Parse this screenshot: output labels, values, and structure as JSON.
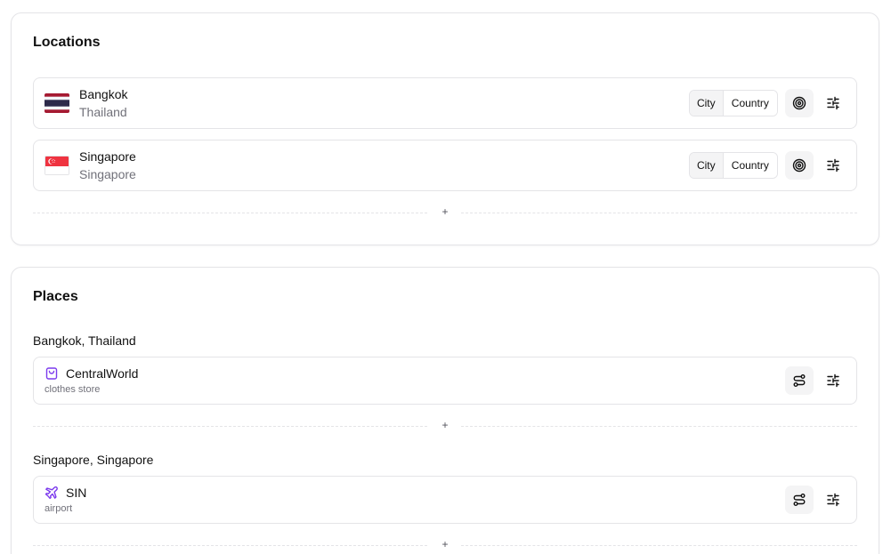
{
  "locations": {
    "title": "Locations",
    "items": [
      {
        "city": "Bangkok",
        "country": "Thailand",
        "flag": "thailand-flag-icon",
        "city_label": "City",
        "country_label": "Country"
      },
      {
        "city": "Singapore",
        "country": "Singapore",
        "flag": "singapore-flag-icon",
        "city_label": "City",
        "country_label": "Country"
      }
    ],
    "add_label": "+"
  },
  "places": {
    "title": "Places",
    "groups": [
      {
        "title": "Bangkok, Thailand",
        "place": {
          "name": "CentralWorld",
          "type": "clothes store",
          "icon": "shopping-bag-icon"
        },
        "add_label": "+"
      },
      {
        "title": "Singapore, Singapore",
        "place": {
          "name": "SIN",
          "type": "airport",
          "icon": "plane-icon"
        },
        "add_label": "+"
      }
    ]
  },
  "colors": {
    "accent": "#7c3aed",
    "border": "#e4e4e7",
    "muted_text": "#71717a",
    "button_bg": "#f4f4f5"
  }
}
